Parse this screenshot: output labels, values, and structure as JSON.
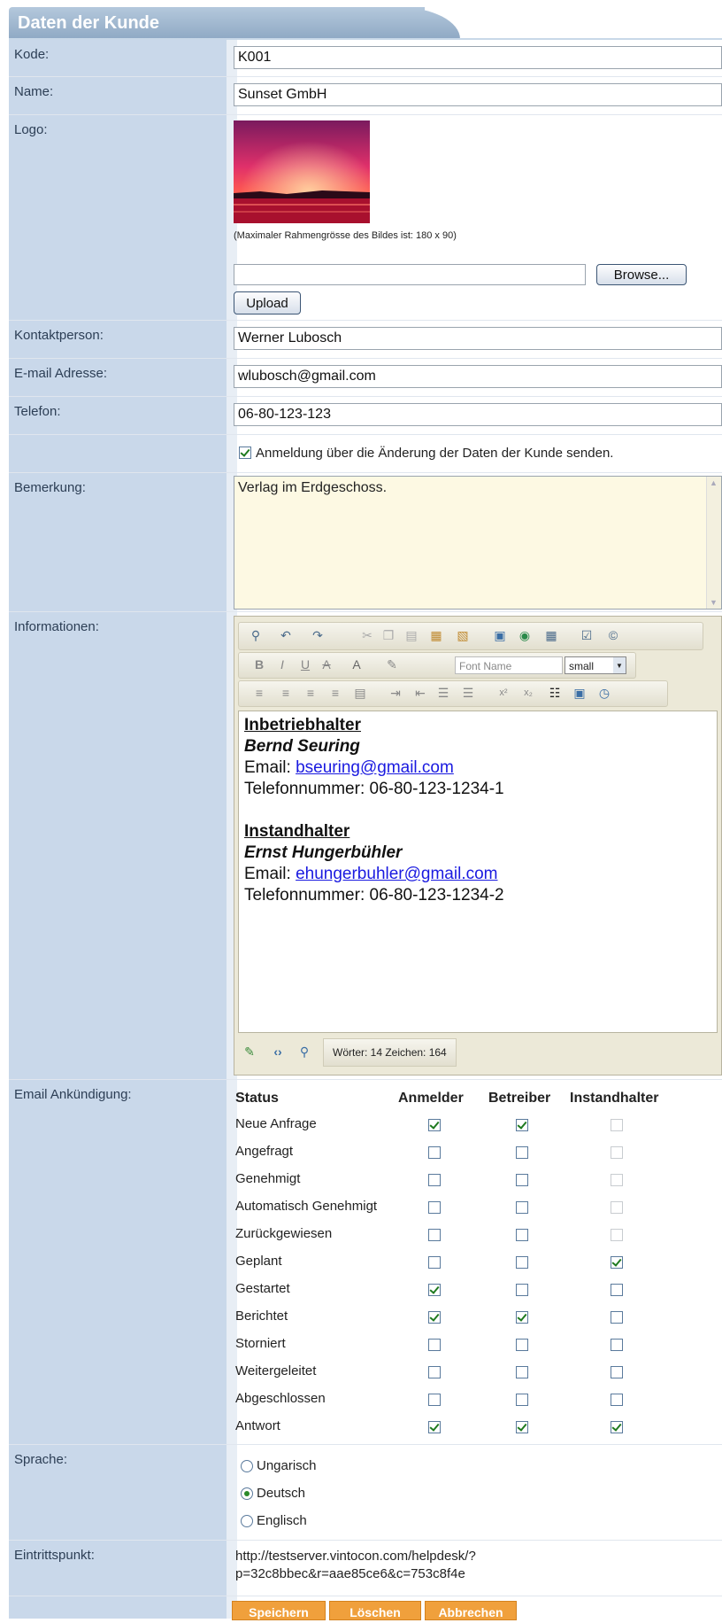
{
  "header": {
    "title": "Daten der Kunde"
  },
  "fields": {
    "kode": {
      "label": "Kode:",
      "value": "K001"
    },
    "name": {
      "label": "Name:",
      "value": "Sunset GmbH"
    },
    "logo": {
      "label": "Logo:",
      "note": "(Maximaler Rahmengrösse des Bildes ist: 180 x 90)",
      "browse": "Browse...",
      "upload": "Upload"
    },
    "kontakt": {
      "label": "Kontaktperson:",
      "value": "Werner Lubosch"
    },
    "email": {
      "label": "E-mail Adresse:",
      "value": "wlubosch@gmail.com"
    },
    "telefon": {
      "label": "Telefon:",
      "value": "06-80-123-123"
    },
    "notify": {
      "label": "Anmeldung über die Änderung der Daten der Kunde senden.",
      "checked": true
    },
    "bemerkung": {
      "label": "Bemerkung:",
      "value": "Verlag im Erdgeschoss."
    },
    "informationen": {
      "label": "Informationen:"
    }
  },
  "editor": {
    "font_name": "Font Name",
    "font_size": "small",
    "status": "Wörter: 14 Zeichen: 164",
    "content": {
      "h1": "Inbetriebhalter",
      "n1": "Bernd Seuring",
      "email_prefix": "Email: ",
      "e1": "bseuring@gmail.com",
      "t1": "Telefonnummer: 06-80-123-1234-1",
      "h2": "Instandhalter",
      "n2": "Ernst Hungerbühler",
      "e2": "ehungerbuhler@gmail.com",
      "t2": "Telefonnummer: 06-80-123-1234-2"
    }
  },
  "announce": {
    "label": "Email Ankündigung:",
    "headers": [
      "Status",
      "Anmelder",
      "Betreiber",
      "Instandhalter"
    ],
    "rows": [
      {
        "status": "Neue Anfrage",
        "a": "on",
        "b": "on",
        "c": "dis"
      },
      {
        "status": "Angefragt",
        "a": "off",
        "b": "off",
        "c": "dis"
      },
      {
        "status": "Genehmigt",
        "a": "off",
        "b": "off",
        "c": "dis"
      },
      {
        "status": "Automatisch Genehmigt",
        "a": "off",
        "b": "off",
        "c": "dis"
      },
      {
        "status": "Zurückgewiesen",
        "a": "off",
        "b": "off",
        "c": "dis"
      },
      {
        "status": "Geplant",
        "a": "off",
        "b": "off",
        "c": "on"
      },
      {
        "status": "Gestartet",
        "a": "on",
        "b": "off",
        "c": "off"
      },
      {
        "status": "Berichtet",
        "a": "on",
        "b": "on",
        "c": "off"
      },
      {
        "status": "Storniert",
        "a": "off",
        "b": "off",
        "c": "off"
      },
      {
        "status": "Weitergeleitet",
        "a": "off",
        "b": "off",
        "c": "off"
      },
      {
        "status": "Abgeschlossen",
        "a": "off",
        "b": "off",
        "c": "off"
      },
      {
        "status": "Antwort",
        "a": "on",
        "b": "on",
        "c": "on"
      }
    ]
  },
  "sprache": {
    "label": "Sprache:",
    "options": [
      "Ungarisch",
      "Deutsch",
      "Englisch"
    ],
    "selected": "Deutsch"
  },
  "eintritt": {
    "label": "Eintrittspunkt:",
    "line1": "http://testserver.vintocon.com/helpdesk/?",
    "line2": "p=32c8bbec&r=aae85ce6&c=753c8f4e"
  },
  "actions": {
    "save": "Speichern",
    "delete": "Löschen",
    "cancel": "Abbrechen"
  },
  "colors": {
    "label_bg": "#c9d8ea",
    "accent": "#f0a03c",
    "note_bg": "#fdf9e3"
  }
}
